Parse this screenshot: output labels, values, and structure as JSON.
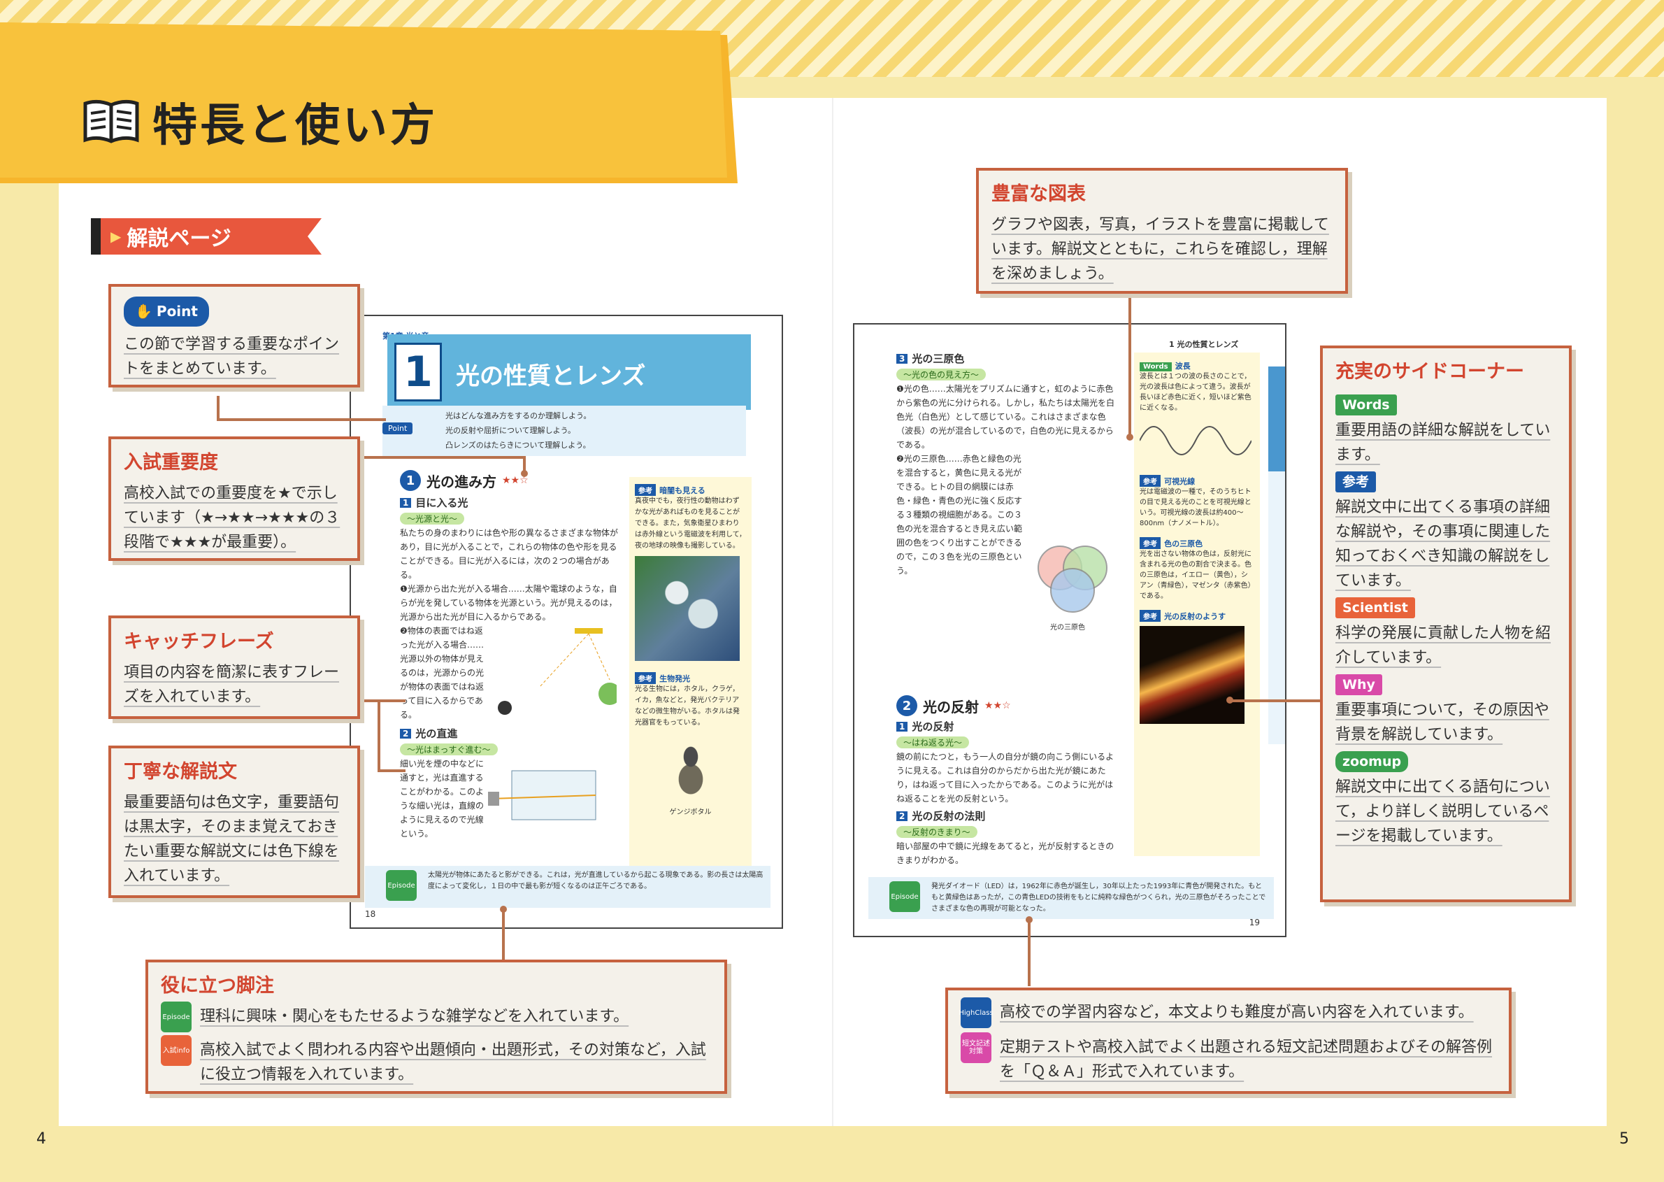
{
  "header": {
    "title": "特長と使い方",
    "section_tag": "解説ページ"
  },
  "callouts": {
    "point": {
      "badge": "Point",
      "body": "この節で学習する重要なポイントをまとめています。"
    },
    "importance": {
      "title": "入試重要度",
      "body": "高校入試での重要度を★で示しています（★→★★→★★★の３段階で★★★が最重要）。"
    },
    "catchphrase": {
      "title": "キャッチフレーズ",
      "body": "項目の内容を簡潔に表すフレーズを入れています。"
    },
    "explanation": {
      "title": "丁寧な解説文",
      "body": "最重要語句は色文字，重要語句は黒太字，そのまま覚えておきたい重要な解説文には色下線を入れています。"
    },
    "figures": {
      "title": "豊富な図表",
      "body": "グラフや図表，写真，イラストを豊富に掲載しています。解説文とともに，これらを確認し，理解を深めましょう。"
    },
    "side_corners": {
      "title": "充実のサイドコーナー",
      "items": [
        {
          "badge": "Words",
          "color": "#3aa04f",
          "text": "重要用語の詳細な解説をしています。"
        },
        {
          "badge": "参考",
          "color": "#1c5aa8",
          "text": "解説文中に出てくる事項の詳細な解説や，その事項に関連した知っておくべき知識の解説をしています。"
        },
        {
          "badge": "Scientist",
          "color": "#e8633a",
          "text": "科学の発展に貢献した人物を紹介しています。"
        },
        {
          "badge": "Why",
          "color": "#d94aa8",
          "text": "重要事項について，その原因や背景を解説しています。"
        },
        {
          "badge": "zoomup",
          "color": "#3aa04f",
          "text": "解説文中に出てくる語句について，より詳しく説明しているページを掲載しています。"
        }
      ]
    },
    "footnotes": {
      "title": "役に立つ脚注",
      "items": [
        {
          "icon": "Episode",
          "color": "#3aa04f",
          "text": "理科に興味・関心をもたせるような雑学などを入れています。"
        },
        {
          "icon": "入試info",
          "color": "#e8633a",
          "text": "高校入試でよく問われる内容や出題傾向・出題形式，その対策など，入試に役立つ情報を入れています。"
        }
      ]
    },
    "advanced": {
      "items": [
        {
          "icon": "HighClass",
          "color": "#1c5aa8",
          "text": "高校での学習内容など，本文よりも難度が高い内容を入れています。"
        },
        {
          "icon": "短文記述対策",
          "color": "#d94aa8",
          "text": "定期テストや高校入試でよく出題される短文記述問題およびその解答例を「Ｑ＆Ａ」形式で入れています。"
        }
      ]
    }
  },
  "left_page": {
    "chapter": "第1章 光と音",
    "number": "1",
    "title": "光の性質とレンズ",
    "point_label": "Point",
    "points": [
      "光はどんな進み方をするのか理解しよう。",
      "光の反射や屈折について理解しよう。",
      "凸レンズのはたらきについて理解しよう。"
    ],
    "sec1": {
      "num": "1",
      "title": "光の進み方",
      "stars": "★★☆"
    },
    "sub1": {
      "num": "1",
      "title": "目に入る光",
      "catch": "〜光源と光〜"
    },
    "text1": "私たちの身のまわりには色や形の異なるさまざまな物体があり，目に光が入ることで，これらの物体の色や形を見ることができる。目に光が入るには，次の２つの場合がある。",
    "text2": "❶光源から出た光が入る場合……太陽や電球のような，自らが光を発している物体を光源という。光が見えるのは，光源から出た光が目に入るからである。",
    "text3": "❷物体の表面ではね返った光が入る場合……光源以外の物体が見えるのは，光源からの光が物体の表面ではね返って目に入るからである。",
    "sub2": {
      "num": "2",
      "title": "光の直進",
      "catch": "〜光はまっすぐ進む〜"
    },
    "text4": "細い光を煙の中などに通すと，光は直進することがわかる。このような細い光は，直線のように見えるので光線という。",
    "side1": {
      "label": "参考",
      "title": "暗闇も見える",
      "text": "真夜中でも，夜行性の動物はわずかな光があればものを見ることができる。また，気象衛星ひまわりは赤外線という電磁波を利用して，夜の地球の映像も撮影している。"
    },
    "side2": {
      "label": "参考",
      "title": "生物発光",
      "text": "光る生物には，ホタル，クラゲ，イカ，魚などと，発光バクテリアなどの微生物がいる。ホタルは発光器官をもっている。"
    },
    "caption_firefly": "ゲンジボタル",
    "episode": "太陽光が物体にあたると影ができる。これは，光が直進しているから起こる現象である。影の長さは太陽高度によって変化し，１日の中で最も影が短くなるのは正午ごろである。",
    "page_num": "18"
  },
  "right_page": {
    "chapter_head": "1 光の性質とレンズ",
    "sub3": {
      "num": "3",
      "title": "光の三原色",
      "catch": "〜光の色の見え方〜"
    },
    "text1": "❶光の色……太陽光をプリズムに通すと，虹のように赤色から紫色の光に分けられる。しかし，私たちは太陽光を白色光（白色光）として感じている。これはさまざまな色（波長）の光が混合しているので，白色の光に見えるからである。",
    "text2": "❷光の三原色……赤色と緑色の光を混合すると，黄色に見える光ができる。ヒトの目の網膜には赤色・緑色・青色の光に強く反応する３種類の視細胞がある。この３色の光を混合するとき見え広い範囲の色をつくり出すことができるので，この３色を光の三原色という。",
    "venn_caption": "光の三原色",
    "sec2": {
      "num": "2",
      "title": "光の反射",
      "stars": "★★☆"
    },
    "sub4": {
      "num": "1",
      "title": "光の反射",
      "catch": "〜はね返る光〜"
    },
    "text3": "鏡の前にたつと，もう一人の自分が鏡の向こう側にいるように見える。これは自分のからだから出た光が鏡にあたり，はね返って目に入ったからである。このように光がはね返ることを光の反射という。",
    "sub5": {
      "num": "2",
      "title": "光の反射の法則",
      "catch": "〜反射のきまり〜"
    },
    "text4": "暗い部屋の中で鏡に光線をあてると，光が反射するときのきまりがわかる。",
    "words": {
      "label": "Words",
      "title": "波長",
      "text": "波長とは１つの波の長さのことで，光の波長は色によって違う。波長が長いほど赤色に近く，短いほど紫色に近くなる。"
    },
    "side3": {
      "label": "参考",
      "title": "可視光線",
      "text": "光は電磁波の一種で，そのうちヒトの目で見える光のことを可視光線という。可視光線の波長は約400〜800nm（ナノメートル）。"
    },
    "side4": {
      "label": "参考",
      "title": "色の三原色",
      "text": "光を出さない物体の色は，反射光に含まれる光の色の割合で決まる。色の三原色は，イエロー（黄色），シアン（青緑色），マゼンタ（赤紫色）である。"
    },
    "side5": {
      "label": "参考",
      "title": "光の反射のようす"
    },
    "episode": "発光ダイオード（LED）は，1962年に赤色が誕生し，30年以上たった1993年に青色が開発された。もともと黄緑色はあったが，この青色LEDの技術をもとに純粋な緑色がつくられ，光の三原色がそろったことでさまざまな色の再現が可能となった。",
    "page_num": "19"
  },
  "page_numbers": {
    "left": "4",
    "right": "5"
  }
}
